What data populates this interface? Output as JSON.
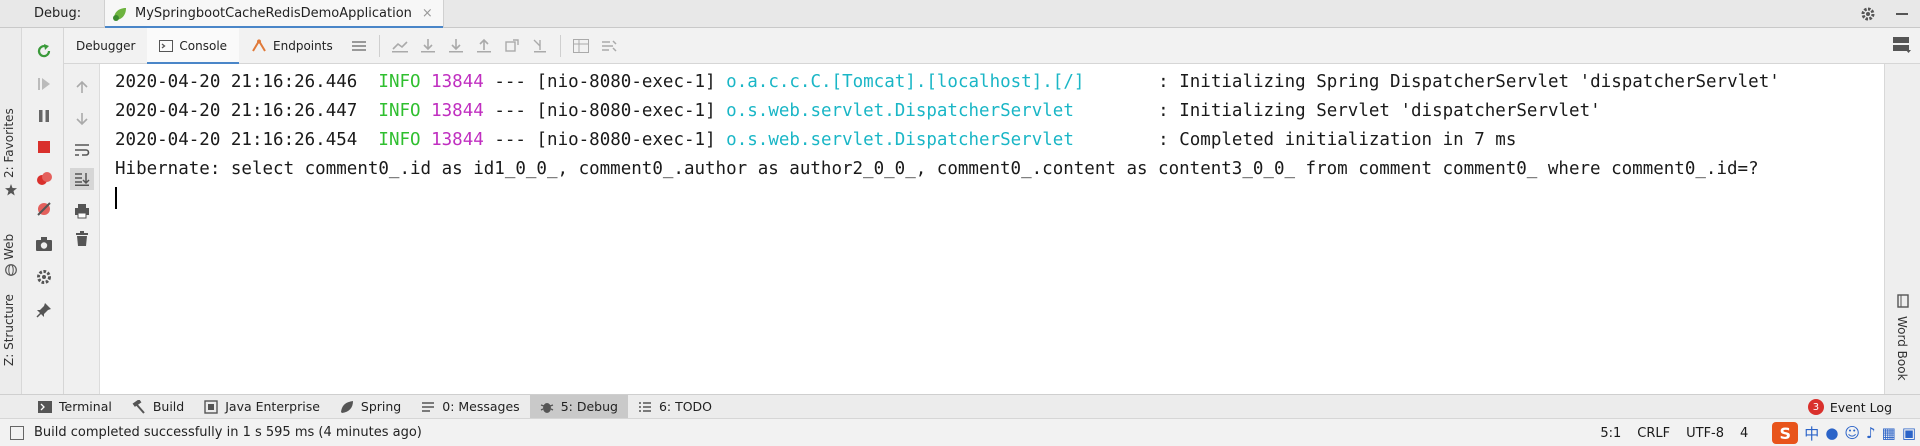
{
  "titlebar": {
    "label": "Debug:",
    "run_tab": "MySpringbootCacheRedisDemoApplication",
    "close_glyph": "×"
  },
  "left_strip": {
    "favorites": "2: Favorites",
    "web": "Web",
    "structure": "Z: Structure"
  },
  "tabs": [
    {
      "label": "Debugger",
      "icon": "none"
    },
    {
      "label": "Console",
      "icon": "console-icon"
    },
    {
      "label": "Endpoints",
      "icon": "endpoints-icon"
    }
  ],
  "console": {
    "lines": [
      {
        "ts": "2020-04-20 21:16:26.446",
        "level": "INFO",
        "pid": "13844",
        "sep": "---",
        "thread": "[nio-8080-exec-1]",
        "logger": "o.a.c.c.C.[Tomcat].[localhost].[/]      ",
        "msg": ": Initializing Spring DispatcherServlet 'dispatcherServlet'"
      },
      {
        "ts": "2020-04-20 21:16:26.447",
        "level": "INFO",
        "pid": "13844",
        "sep": "---",
        "thread": "[nio-8080-exec-1]",
        "logger": "o.s.web.servlet.DispatcherServlet       ",
        "msg": ": Initializing Servlet 'dispatcherServlet'"
      },
      {
        "ts": "2020-04-20 21:16:26.454",
        "level": "INFO",
        "pid": "13844",
        "sep": "---",
        "thread": "[nio-8080-exec-1]",
        "logger": "o.s.web.servlet.DispatcherServlet       ",
        "msg": ": Completed initialization in 7 ms"
      }
    ],
    "hibernate": "Hibernate: select comment0_.id as id1_0_0_, comment0_.author as author2_0_0_, comment0_.content as content3_0_0_ from comment comment0_ where comment0_.id=?"
  },
  "right_strip": {
    "label": "Word Book"
  },
  "bottom_tools": [
    {
      "label": "Terminal",
      "icon": "terminal-icon"
    },
    {
      "label": "Build",
      "icon": "hammer-icon"
    },
    {
      "label": "Java Enterprise",
      "icon": "java-enterprise-icon"
    },
    {
      "label": "Spring",
      "icon": "spring-leaf-icon"
    },
    {
      "label": "0: Messages",
      "icon": "messages-icon"
    },
    {
      "label": "5: Debug",
      "icon": "bug-icon",
      "active": true
    },
    {
      "label": "6: TODO",
      "icon": "todo-icon"
    }
  ],
  "event_log": {
    "count": "3",
    "label": "Event Log"
  },
  "status": {
    "message": "Build completed successfully in 1 s 595 ms (4 minutes ago)",
    "position": "5:1",
    "line_sep": "CRLF",
    "encoding": "UTF-8",
    "indent": "4",
    "ime_label": "中"
  },
  "colors": {
    "info": "#2fbf2f",
    "pid": "#c02fc0",
    "logger": "#1ab6c6",
    "tab_accent": "#4a86c8",
    "badge": "#d9302c"
  }
}
